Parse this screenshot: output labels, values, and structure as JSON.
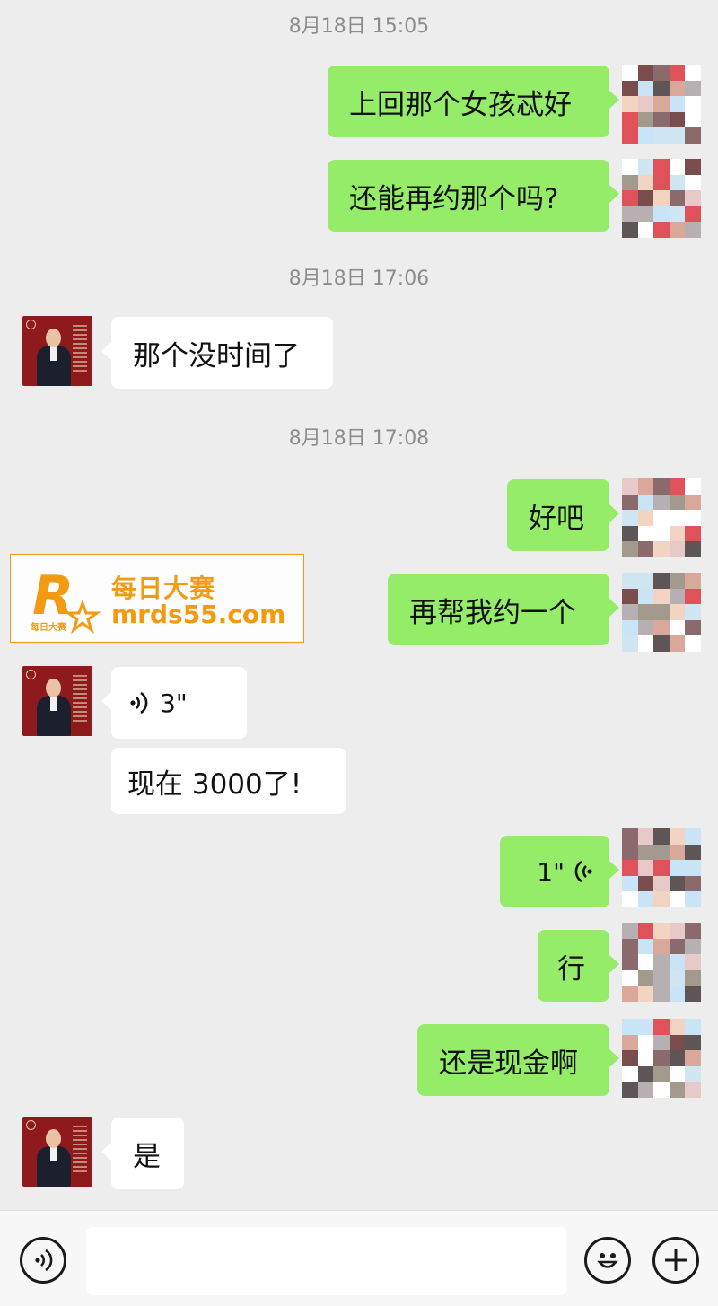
{
  "timestamps": [
    "8月18日 15:05",
    "8月18日 17:06",
    "8月18日 17:08"
  ],
  "messages": [
    {
      "side": "right",
      "type": "text",
      "text": "上回那个女孩忒好"
    },
    {
      "side": "right",
      "type": "text",
      "text": "还能再约那个吗?"
    },
    {
      "side": "left",
      "type": "text",
      "text": "那个没时间了"
    },
    {
      "side": "right",
      "type": "text",
      "text": "好吧"
    },
    {
      "side": "right",
      "type": "text",
      "text": "再帮我约一个"
    },
    {
      "side": "left",
      "type": "voice",
      "duration": "3\""
    },
    {
      "side": "left",
      "type": "text",
      "text": "现在 3000了!"
    },
    {
      "side": "right",
      "type": "voice",
      "duration": "1\""
    },
    {
      "side": "right",
      "type": "text",
      "text": "行"
    },
    {
      "side": "right",
      "type": "text",
      "text": "还是现金啊"
    },
    {
      "side": "left",
      "type": "text",
      "text": "是"
    }
  ],
  "watermark": {
    "name": "每日大赛",
    "domain": "mrds55.com",
    "logo_letter": "R",
    "logo_caption": "每日大赛",
    "color": "#f29a12"
  },
  "input_bar": {
    "voice_icon": "voice-mode-icon",
    "emoji_icon": "emoji-icon",
    "plus_icon": "plus-icon",
    "value": ""
  },
  "colors": {
    "sent_bubble": "#95ec69",
    "received_bubble": "#ffffff",
    "background": "#ededed"
  }
}
